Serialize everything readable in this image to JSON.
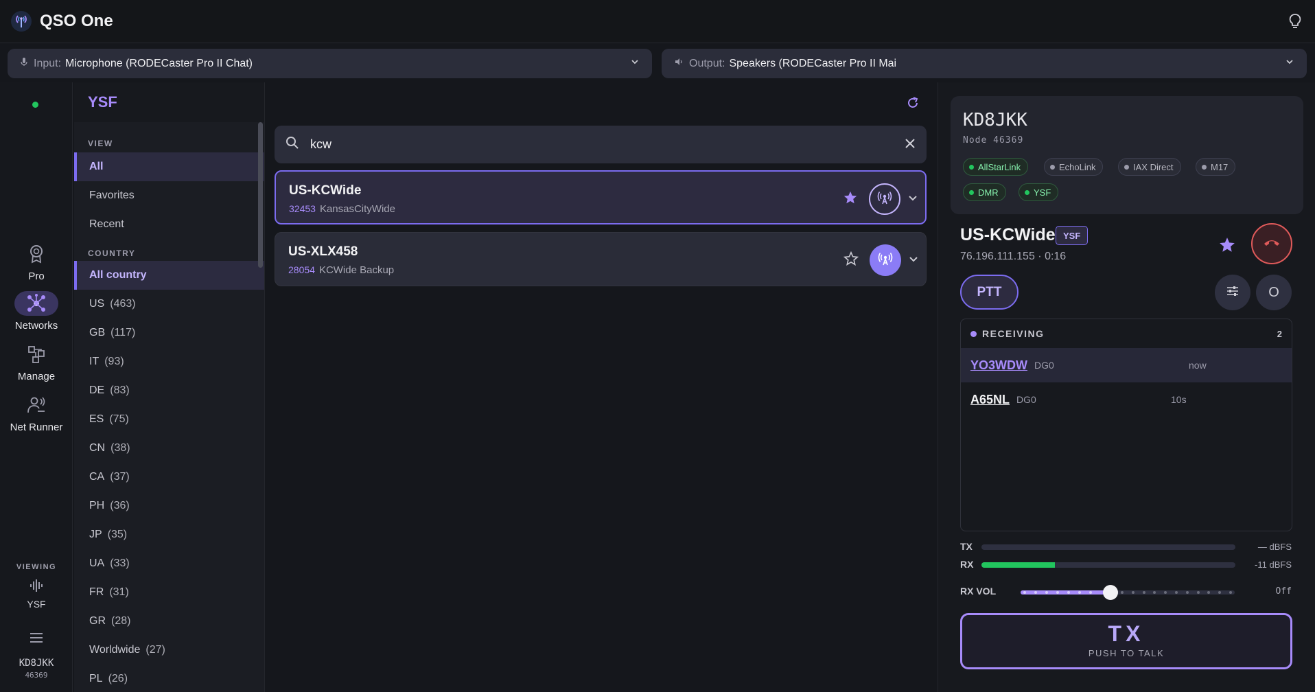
{
  "app": {
    "title": "QSO One"
  },
  "audio": {
    "input_label": "Input:",
    "input_value": "Microphone (RODECaster Pro II Chat)",
    "output_label": "Output:",
    "output_value": "Speakers (RODECaster Pro II Mai"
  },
  "rail": {
    "items": [
      {
        "label": "Pro",
        "icon": "award-icon"
      },
      {
        "label": "Networks",
        "icon": "network-icon",
        "active": true
      },
      {
        "label": "Manage",
        "icon": "manage-icon"
      },
      {
        "label": "Net Runner",
        "icon": "net-runner-icon"
      }
    ],
    "viewing_label": "VIEWING",
    "viewing_value": "YSF",
    "user": "KD8JKK",
    "node": "46369",
    "status_color": "#22c55e"
  },
  "filter": {
    "title": "YSF",
    "view_label": "VIEW",
    "view_items": [
      "All",
      "Favorites",
      "Recent"
    ],
    "country_label": "COUNTRY",
    "country_all": "All country",
    "countries": [
      {
        "code": "US",
        "count": "(463)"
      },
      {
        "code": "GB",
        "count": "(117)"
      },
      {
        "code": "IT",
        "count": "(93)"
      },
      {
        "code": "DE",
        "count": "(83)"
      },
      {
        "code": "ES",
        "count": "(75)"
      },
      {
        "code": "CN",
        "count": "(38)"
      },
      {
        "code": "CA",
        "count": "(37)"
      },
      {
        "code": "PH",
        "count": "(36)"
      },
      {
        "code": "JP",
        "count": "(35)"
      },
      {
        "code": "UA",
        "count": "(33)"
      },
      {
        "code": "FR",
        "count": "(31)"
      },
      {
        "code": "GR",
        "count": "(28)"
      },
      {
        "code": "Worldwide",
        "count": "(27)"
      },
      {
        "code": "PL",
        "count": "(26)"
      }
    ]
  },
  "search": {
    "query": "kcw"
  },
  "results": [
    {
      "name": "US-KCWide",
      "id": "32453",
      "desc": "KansasCityWide",
      "favorite": true,
      "connected": true
    },
    {
      "name": "US-XLX458",
      "id": "28054",
      "desc": "KCWide Backup",
      "favorite": false,
      "connected": false
    }
  ],
  "station": {
    "callsign": "KD8JKK",
    "node": "Node 46369",
    "badges": [
      {
        "label": "AllStarLink",
        "on": true
      },
      {
        "label": "EchoLink",
        "on": false
      },
      {
        "label": "IAX Direct",
        "on": false
      },
      {
        "label": "M17",
        "on": false
      },
      {
        "label": "DMR",
        "on": true
      },
      {
        "label": "YSF",
        "on": true
      }
    ]
  },
  "connection": {
    "name": "US-KCWide",
    "mode": "YSF",
    "meta": "76.196.111.155 · 0:16",
    "ptt_label": "PTT",
    "round_button_label": "O"
  },
  "receiving": {
    "title": "RECEIVING",
    "count": "2",
    "rows": [
      {
        "callsign": "YO3WDW",
        "dg": "DG0",
        "time": "now",
        "color": "#a78bfa"
      },
      {
        "callsign": "A65NL",
        "dg": "DG0",
        "time": "10s",
        "color": "#f2f2f4"
      }
    ]
  },
  "meters": {
    "tx_label": "TX",
    "tx_value": "— dBFS",
    "tx_level": 0,
    "rx_label": "RX",
    "rx_value": "-11 dBFS",
    "rx_level": 0.29,
    "vol_label": "RX VOL",
    "vol_value": "Off",
    "vol_level": 0.42
  },
  "tx_button": {
    "big": "TX",
    "small": "PUSH TO TALK"
  },
  "colors": {
    "accent": "#a78bfa",
    "green": "#22c55e",
    "danger": "#e05a5a"
  }
}
